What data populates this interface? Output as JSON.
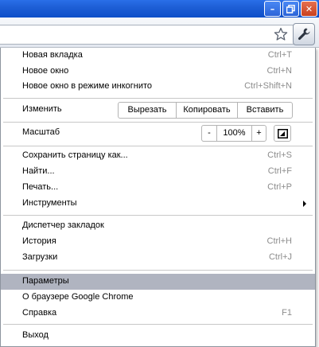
{
  "window": {
    "minimize_glyph": "–",
    "close_glyph": "✕"
  },
  "toolbar": {
    "bookmark_icon": "star-icon",
    "menu_icon": "wrench-icon"
  },
  "menu": {
    "new_tab": {
      "label": "Новая вкладка",
      "shortcut": "Ctrl+T"
    },
    "new_window": {
      "label": "Новое окно",
      "shortcut": "Ctrl+N"
    },
    "incognito": {
      "label": "Новое окно в режиме инкогнито",
      "shortcut": "Ctrl+Shift+N"
    },
    "edit": {
      "label": "Изменить",
      "cut": "Вырезать",
      "copy": "Копировать",
      "paste": "Вставить"
    },
    "zoom": {
      "label": "Масштаб",
      "minus": "-",
      "value": "100%",
      "plus": "+"
    },
    "save_page": {
      "label": "Сохранить страницу как...",
      "shortcut": "Ctrl+S"
    },
    "find": {
      "label": "Найти...",
      "shortcut": "Ctrl+F"
    },
    "print": {
      "label": "Печать...",
      "shortcut": "Ctrl+P"
    },
    "tools": {
      "label": "Инструменты"
    },
    "bookmark_manager": {
      "label": "Диспетчер закладок"
    },
    "history": {
      "label": "История",
      "shortcut": "Ctrl+H"
    },
    "downloads": {
      "label": "Загрузки",
      "shortcut": "Ctrl+J"
    },
    "settings": {
      "label": "Параметры"
    },
    "about": {
      "label": "О браузере Google Chrome"
    },
    "help": {
      "label": "Справка",
      "shortcut": "F1"
    },
    "exit": {
      "label": "Выход"
    }
  },
  "colors": {
    "titlebar": "#1e5fd6",
    "selected_row": "#b0b4c0",
    "shortcut_text": "#8c8c8c"
  }
}
